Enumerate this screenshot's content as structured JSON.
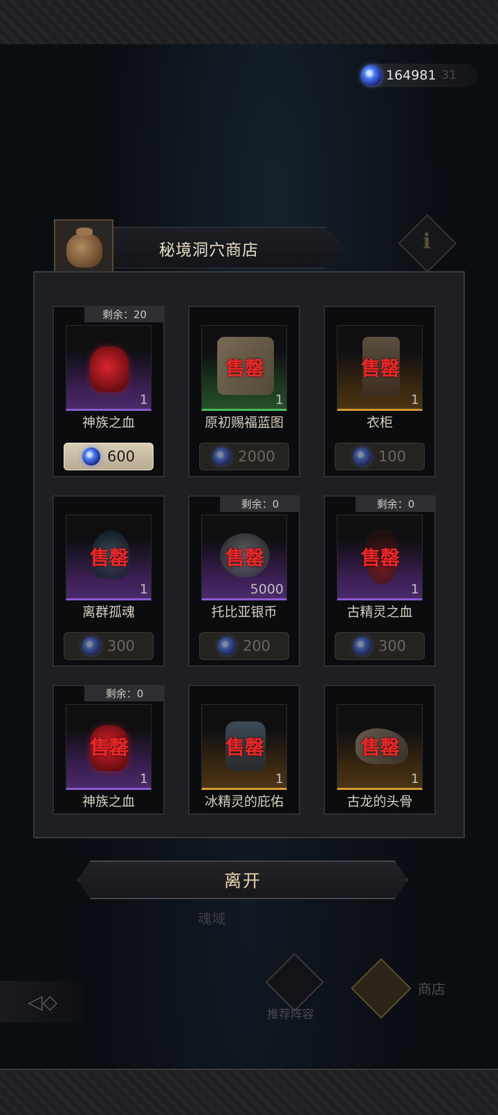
{
  "currency": {
    "amount": "164981",
    "ghost_text": "31",
    "icon": "soul-orb-icon"
  },
  "shop": {
    "title": "秘境洞穴商店",
    "icon": "money-bag-icon",
    "info_icon": "info-icon"
  },
  "sold_out_label": "售罄",
  "items": [
    {
      "name": "神族之血",
      "stock": "剩余：20",
      "qty": "1",
      "price": "600",
      "sold_out": false,
      "rarity": "purple"
    },
    {
      "name": "原初赐福蓝图",
      "stock": "",
      "qty": "1",
      "price": "2000",
      "sold_out": true,
      "rarity": "green"
    },
    {
      "name": "衣柜",
      "stock": "",
      "qty": "1",
      "price": "100",
      "sold_out": true,
      "rarity": "orange"
    },
    {
      "name": "离群孤魂",
      "stock": "",
      "qty": "1",
      "price": "300",
      "sold_out": true,
      "rarity": "purple"
    },
    {
      "name": "托比亚银币",
      "stock": "剩余：0",
      "qty": "5000",
      "price": "200",
      "sold_out": true,
      "rarity": "purple"
    },
    {
      "name": "古精灵之血",
      "stock": "剩余：0",
      "qty": "1",
      "price": "300",
      "sold_out": true,
      "rarity": "purple"
    },
    {
      "name": "神族之血",
      "stock": "剩余：0",
      "qty": "1",
      "price": "",
      "sold_out": true,
      "rarity": "purple"
    },
    {
      "name": "冰精灵的庇佑",
      "stock": "",
      "qty": "1",
      "price": "",
      "sold_out": true,
      "rarity": "orange"
    },
    {
      "name": "古龙的头骨",
      "stock": "",
      "qty": "1",
      "price": "",
      "sold_out": true,
      "rarity": "orange"
    }
  ],
  "leave_button": "离开",
  "background_text": "魂域",
  "bottom_nav": {
    "lineup_label": "推荐阵容",
    "shop_label": "商店"
  }
}
